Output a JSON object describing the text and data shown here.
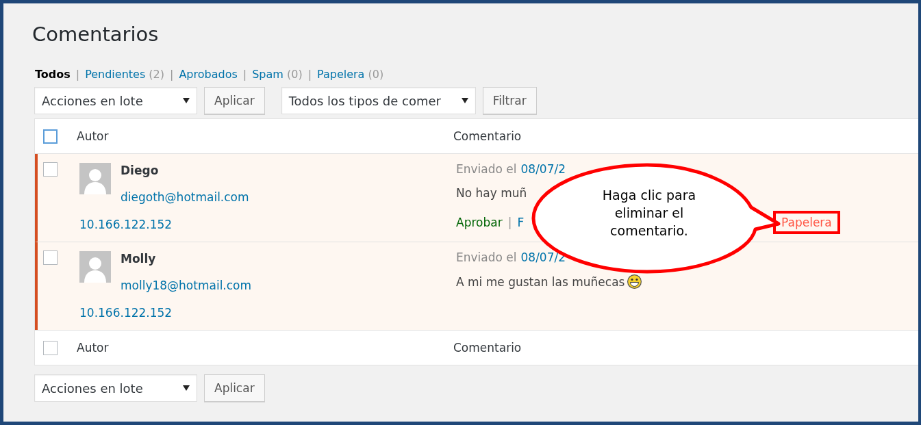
{
  "title": "Comentarios",
  "filters": [
    {
      "label": "Todos",
      "selected": true
    },
    {
      "separator": "|",
      "label": "Pendientes",
      "count": "(2)",
      "selected": false
    },
    {
      "separator": "|",
      "label": "Aprobados",
      "selected": false
    },
    {
      "separator": "|",
      "label": "Spam",
      "count": "(0)",
      "selected": false
    },
    {
      "separator": "|",
      "label": "Papelera",
      "count": "(0)",
      "selected": false
    }
  ],
  "top_actions": {
    "bulk_select": "Acciones en lote",
    "apply": "Aplicar",
    "type_select": "Todos los tipos de comer",
    "filter": "Filtrar"
  },
  "table": {
    "select_all_checked": false,
    "columns": [
      "Autor",
      "Comentario"
    ],
    "rows": [
      {
        "checked": false,
        "name": "Diego",
        "email": "diegoth@hotmail.com",
        "ip": "10.166.122.152",
        "sent_label": "Enviado el",
        "date": "08/07/2",
        "text": "No hay muñ",
        "smiley": false,
        "actions": [
          {
            "kind": "link",
            "label": "Aprobar"
          },
          {
            "kind": "separator",
            "label": "|"
          },
          {
            "kind": "link",
            "label": "F"
          }
        ],
        "trash": {
          "label": "Papelera",
          "highlighted": true
        }
      },
      {
        "checked": false,
        "name": "Molly",
        "email": "molly18@hotmail.com",
        "ip": "10.166.122.152",
        "sent_label": "Enviado el",
        "date": "08/07/2",
        "text": "A mi me gustan las muñecas",
        "smiley": true,
        "actions": [],
        "trash": null
      }
    ],
    "footer_select_all_checked": false,
    "footer_columns": [
      "Autor",
      "Comentario"
    ]
  },
  "bottom_actions": {
    "bulk_select": "Acciones en lote",
    "apply": "Aplicar"
  },
  "callout": {
    "text": "Haga clic para eliminar el comentario."
  }
}
